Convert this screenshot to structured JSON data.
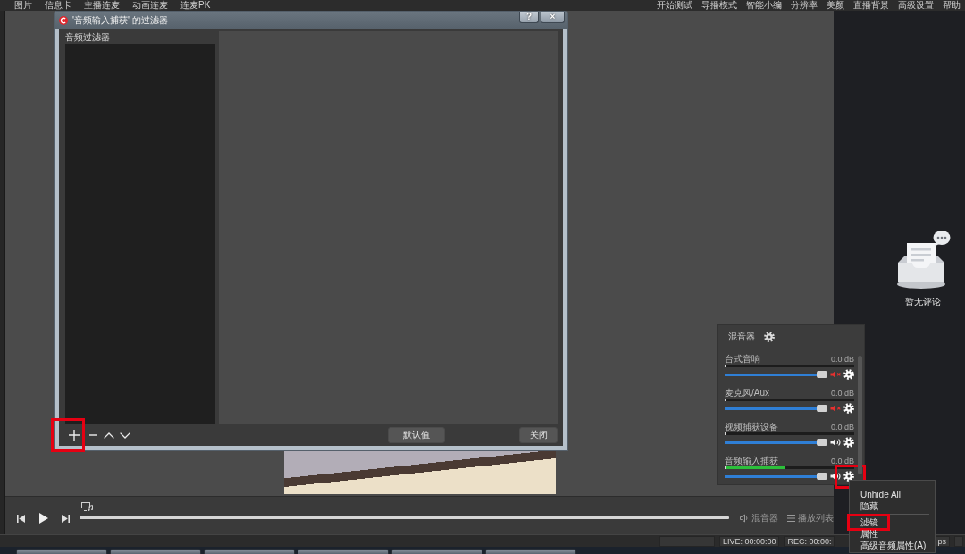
{
  "menu_bar": {
    "left_items": [
      "图片",
      "信息卡",
      "主播连麦",
      "动画连麦",
      "连麦PK"
    ],
    "right_items": [
      "开始测试",
      "导播模式",
      "智能小编",
      "分辨率",
      "美颜",
      "直播背景",
      "高级设置",
      "帮助"
    ]
  },
  "filter_dialog": {
    "title": "'音频输入捕获' 的过滤器",
    "title_buttons": [
      "?",
      "×"
    ],
    "list_label": "音频过滤器",
    "toolbar": [
      {
        "kind": "add",
        "highlighted": true
      },
      {
        "kind": "remove",
        "highlighted": false
      },
      {
        "kind": "move_up",
        "highlighted": false
      },
      {
        "kind": "move_down",
        "highlighted": false
      }
    ],
    "buttons": [
      "默认值",
      "关闭"
    ]
  },
  "mixer": {
    "title": "混音器",
    "channels": [
      {
        "name": "台式音响",
        "reading": "0.0 dB",
        "meter": {
          "level": 0
        },
        "volume": {
          "level": 1
        },
        "muted": true,
        "settings_highlighted": false
      },
      {
        "name": "麦克风/Aux",
        "reading": "0.0 dB",
        "meter": {
          "level": 0
        },
        "volume": {
          "level": 1
        },
        "muted": true,
        "settings_highlighted": false
      },
      {
        "name": "视频捕获设备",
        "reading": "0.0 dB",
        "meter": {
          "level": 0
        },
        "volume": {
          "level": 1
        },
        "muted": false,
        "settings_highlighted": false
      },
      {
        "name": "音频输入捕获",
        "reading": "0.0 dB",
        "meter": {
          "level": 0.47
        },
        "volume": {
          "level": 1
        },
        "muted": false,
        "settings_highlighted": true
      }
    ]
  },
  "context_menu": {
    "items": [
      {
        "kind": "item",
        "label": "Unhide All",
        "highlighted": false
      },
      {
        "kind": "item",
        "label": "隐藏",
        "highlighted": false
      },
      {
        "kind": "separator"
      },
      {
        "kind": "item",
        "label": "滤镜",
        "highlighted": true
      },
      {
        "kind": "item",
        "label": "属性",
        "highlighted": false
      },
      {
        "kind": "item",
        "label": "高级音频属性(A)",
        "highlighted": false
      }
    ]
  },
  "playback_bar": {
    "controls": [
      {
        "kind": "previous"
      },
      {
        "kind": "play"
      },
      {
        "kind": "next"
      }
    ],
    "tabs": [
      {
        "kind": "mixer",
        "label": "混音器"
      },
      {
        "kind": "playlist",
        "label": "播放列表"
      }
    ]
  },
  "comments": {
    "empty_text": "暂无评论"
  },
  "status_bar": {
    "left": [
      "LIVE: 00:00:00",
      "REC: 00:00:"
    ],
    "right": [
      "ps"
    ]
  }
}
